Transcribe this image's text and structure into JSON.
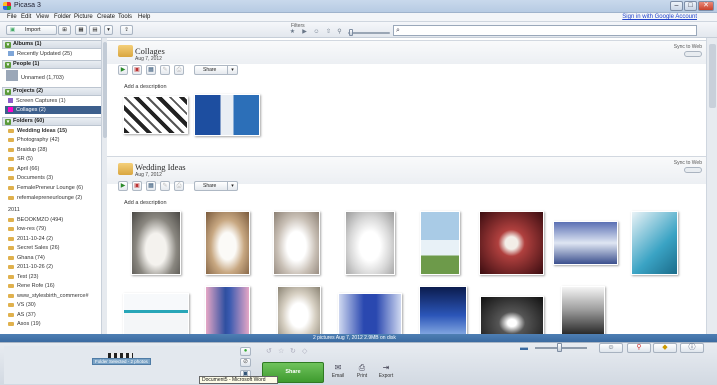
{
  "window": {
    "title": "Picasa 3",
    "controls": {
      "minimize": "–",
      "maximize": "□",
      "close": "✕"
    }
  },
  "menu": {
    "items": [
      "File",
      "Edit",
      "View",
      "Folder",
      "Picture",
      "Create",
      "Tools",
      "Help"
    ],
    "signin": "Sign in with Google Account"
  },
  "toolbar": {
    "import_label": "Import",
    "filters_label": "Filters",
    "search": {
      "value": "",
      "placeholder": ""
    }
  },
  "sidebar": {
    "albums": {
      "header": "Albums (1)",
      "items": [
        {
          "label": "Recently Updated (25)"
        }
      ]
    },
    "people": {
      "header": "People (1)",
      "items": [
        {
          "label": "Unnamed (1,703)"
        }
      ]
    },
    "projects": {
      "header": "Projects (2)",
      "items": [
        {
          "label": "Screen Captures (1)"
        },
        {
          "label": "Collages (2)"
        }
      ]
    },
    "folders": {
      "header": "Folders (60)",
      "items": [
        {
          "label": "Wedding Ideas (15)"
        },
        {
          "label": "Photography (42)"
        },
        {
          "label": "Braidup (28)"
        },
        {
          "label": "SR (5)"
        },
        {
          "label": "April (66)"
        },
        {
          "label": "Documents (3)"
        },
        {
          "label": "FemalePreneur Lounge (6)"
        },
        {
          "label": "refemalepreneurlounge (2)"
        }
      ],
      "year": "2011",
      "year_items": [
        {
          "label": "BEOOKMZO (494)"
        },
        {
          "label": "low-res (79)"
        },
        {
          "label": "2011-10-24 (2)"
        },
        {
          "label": "Secret Sales (26)"
        },
        {
          "label": "Ghana (74)"
        },
        {
          "label": "2011-10-26 (2)"
        },
        {
          "label": "Test (23)"
        },
        {
          "label": "Rene Rofe (16)"
        },
        {
          "label": "www_stylesbirth_commerce#"
        },
        {
          "label": "VS (30)"
        },
        {
          "label": "AS (37)"
        },
        {
          "label": "Asos (19)"
        }
      ]
    }
  },
  "albums": [
    {
      "title": "Collages",
      "date": "Aug 7, 2012",
      "sync_label": "Sync to Web",
      "share_label": "Share",
      "description_placeholder": "Add a description"
    },
    {
      "title": "Wedding Ideas",
      "date": "Aug 7, 2012",
      "sync_label": "Sync to Web",
      "share_label": "Share",
      "description_placeholder": "Add a description"
    }
  ],
  "status": {
    "info": "2 pictures    Aug 7, 2012    2.9MB on disk"
  },
  "tray": {
    "tooltip": "Folder Selected - 2 photos",
    "share_label": "Share",
    "actions": [
      {
        "label": "Email"
      },
      {
        "label": "Print"
      },
      {
        "label": "Export"
      }
    ],
    "taskbar_tip": "Document5 - Microsoft Word"
  },
  "colors": {
    "selection": "#3d5f8c",
    "accent_blue": "#3a6aa0",
    "share_green": "#4ea83c"
  }
}
